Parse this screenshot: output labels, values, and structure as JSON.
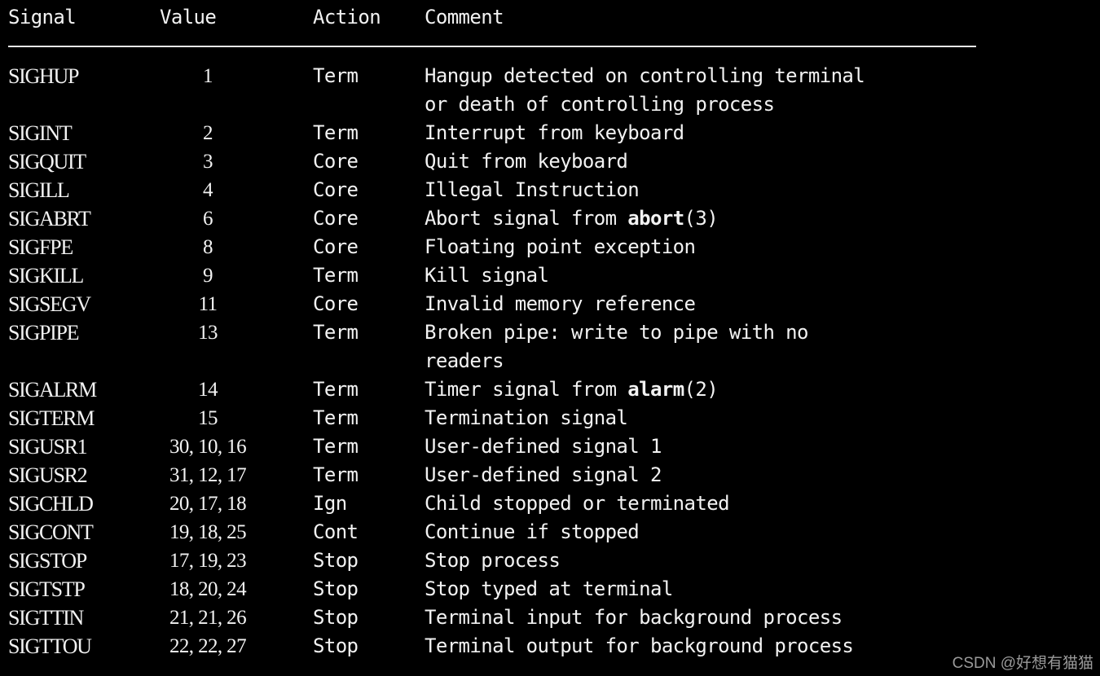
{
  "page": {
    "background_color": "#000000",
    "text_color": "#f2f2f2",
    "watermark": "CSDN @好想有猫猫",
    "watermark_color": "#9a9a9a"
  },
  "table": {
    "columns": [
      "Signal",
      "Value",
      "Action",
      "Comment"
    ],
    "rows": [
      {
        "signal": "SIGHUP",
        "value": "1",
        "action": "Term",
        "comment": "Hangup detected on controlling terminal",
        "comment_cont": "or death of controlling process"
      },
      {
        "signal": "SIGINT",
        "value": "2",
        "action": "Term",
        "comment": "Interrupt from keyboard",
        "comment_cont": ""
      },
      {
        "signal": "SIGQUIT",
        "value": "3",
        "action": "Core",
        "comment": "Quit from keyboard",
        "comment_cont": ""
      },
      {
        "signal": "SIGILL",
        "value": "4",
        "action": "Core",
        "comment": "Illegal Instruction",
        "comment_cont": ""
      },
      {
        "signal": "SIGABRT",
        "value": "6",
        "action": "Core",
        "comment_prefix": "Abort signal from ",
        "comment_bold": "abort",
        "comment_suffix": "(3)",
        "comment_cont": ""
      },
      {
        "signal": "SIGFPE",
        "value": "8",
        "action": "Core",
        "comment": "Floating point exception",
        "comment_cont": ""
      },
      {
        "signal": "SIGKILL",
        "value": "9",
        "action": "Term",
        "comment": "Kill signal",
        "comment_cont": ""
      },
      {
        "signal": "SIGSEGV",
        "value": "11",
        "action": "Core",
        "comment": "Invalid memory reference",
        "comment_cont": ""
      },
      {
        "signal": "SIGPIPE",
        "value": "13",
        "action": "Term",
        "comment": "Broken pipe: write to pipe with no",
        "comment_cont": "readers"
      },
      {
        "signal": "SIGALRM",
        "value": "14",
        "action": "Term",
        "comment_prefix": "Timer signal from ",
        "comment_bold": "alarm",
        "comment_suffix": "(2)",
        "comment_cont": ""
      },
      {
        "signal": "SIGTERM",
        "value": "15",
        "action": "Term",
        "comment": "Termination signal",
        "comment_cont": ""
      },
      {
        "signal": "SIGUSR1",
        "value": "30, 10, 16",
        "action": "Term",
        "comment": "User-defined signal 1",
        "comment_cont": ""
      },
      {
        "signal": "SIGUSR2",
        "value": "31, 12, 17",
        "action": "Term",
        "comment": "User-defined signal 2",
        "comment_cont": ""
      },
      {
        "signal": "SIGCHLD",
        "value": "20, 17, 18",
        "action": "Ign",
        "comment": "Child stopped or terminated",
        "comment_cont": ""
      },
      {
        "signal": "SIGCONT",
        "value": "19, 18, 25",
        "action": "Cont",
        "comment": "Continue if stopped",
        "comment_cont": ""
      },
      {
        "signal": "SIGSTOP",
        "value": "17, 19, 23",
        "action": "Stop",
        "comment": "Stop process",
        "comment_cont": ""
      },
      {
        "signal": "SIGTSTP",
        "value": "18, 20, 24",
        "action": "Stop",
        "comment": "Stop typed at terminal",
        "comment_cont": ""
      },
      {
        "signal": "SIGTTIN",
        "value": "21, 21, 26",
        "action": "Stop",
        "comment": "Terminal input for background process",
        "comment_cont": ""
      },
      {
        "signal": "SIGTTOU",
        "value": "22, 22, 27",
        "action": "Stop",
        "comment": "Terminal output for background process",
        "comment_cont": ""
      }
    ]
  }
}
